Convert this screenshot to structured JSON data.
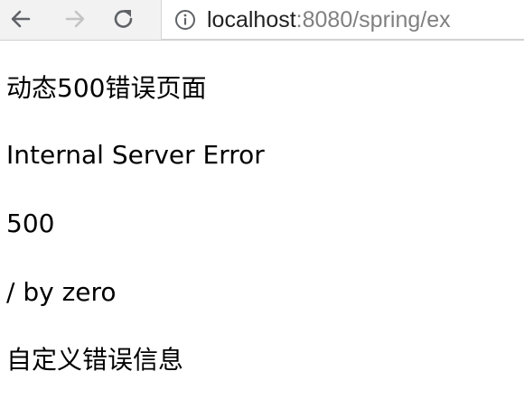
{
  "browser": {
    "url_host": "localhost",
    "url_rest": ":8080/spring/ex"
  },
  "page": {
    "heading": "动态500错误页面",
    "error": "Internal Server Error",
    "status": "500",
    "message": "/ by zero",
    "custom_message": "自定义错误信息"
  },
  "icons": {
    "back": "back-arrow-icon",
    "forward": "forward-arrow-icon",
    "reload": "reload-icon",
    "info": "info-icon"
  }
}
